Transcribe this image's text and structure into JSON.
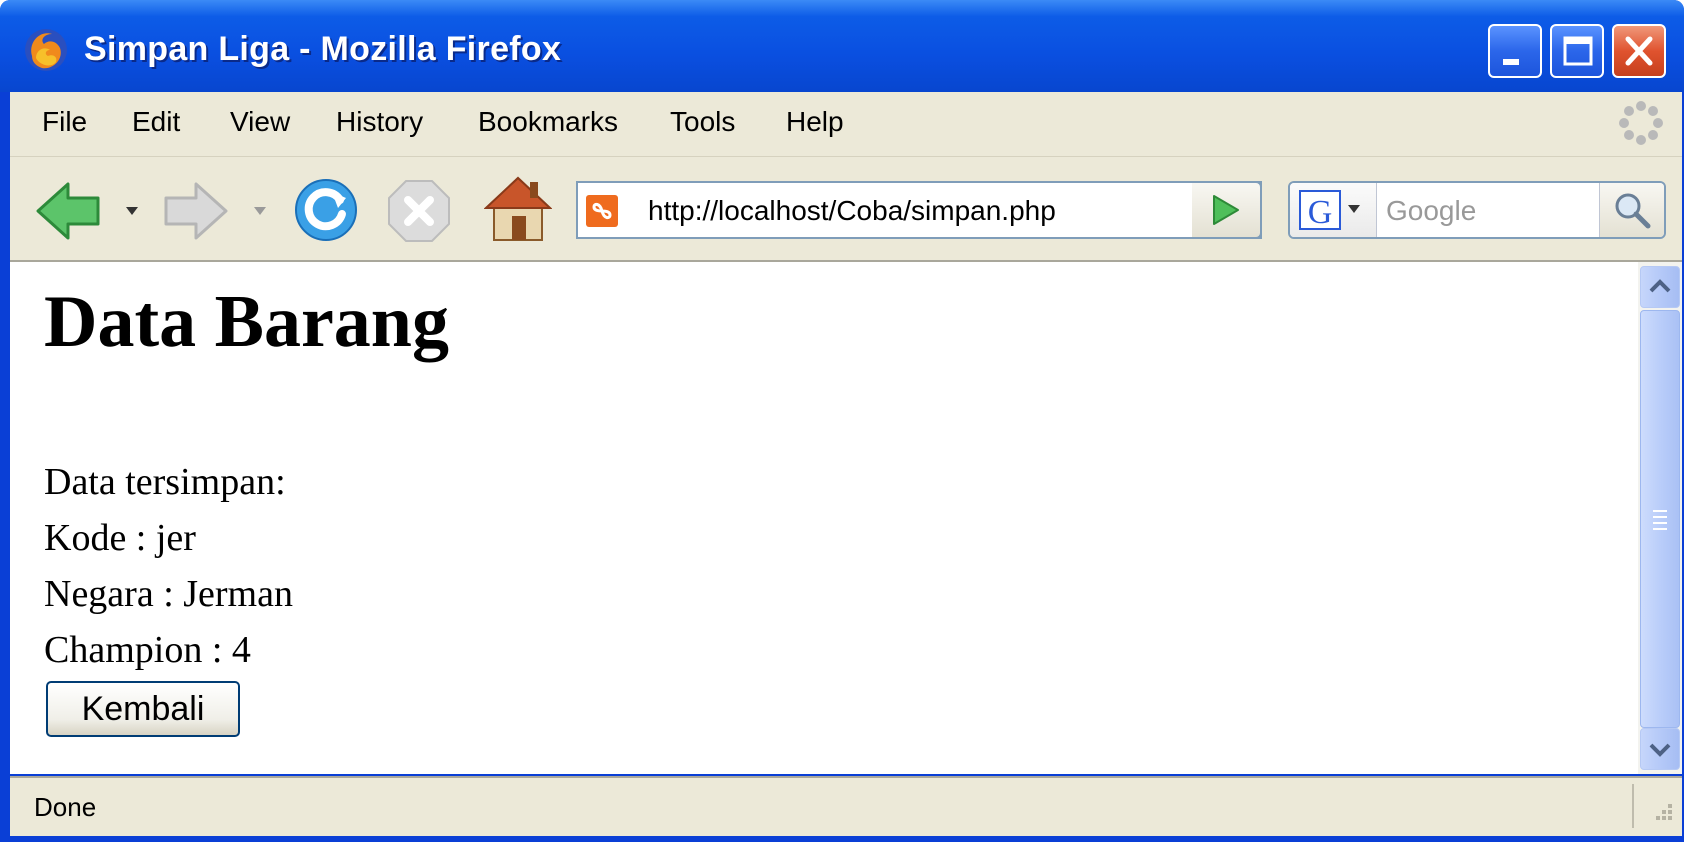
{
  "window": {
    "title": "Simpan Liga - Mozilla Firefox"
  },
  "menu": {
    "items": [
      "File",
      "Edit",
      "View",
      "History",
      "Bookmarks",
      "Tools",
      "Help"
    ]
  },
  "navbar": {
    "url": "http://localhost/Coba/simpan.php",
    "search_placeholder": "Google"
  },
  "page": {
    "heading": "Data Barang",
    "lines": [
      "Data tersimpan:",
      "Kode : jer",
      "Negara : Jerman",
      "Champion : 4"
    ],
    "button_label": "Kembali"
  },
  "status": {
    "text": "Done"
  }
}
